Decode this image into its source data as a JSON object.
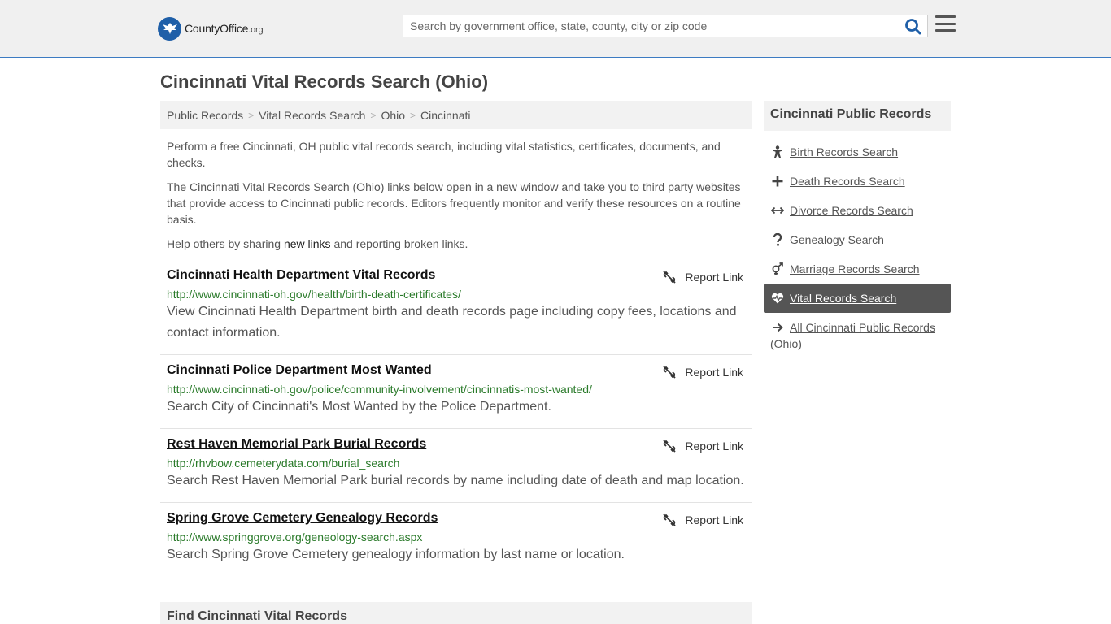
{
  "header": {
    "logo": {
      "brand": "CountyOffice",
      "tld": ".org"
    },
    "search_placeholder": "Search by government office, state, county, city or zip code"
  },
  "page_title": "Cincinnati Vital Records Search (Ohio)",
  "breadcrumb": [
    "Public Records",
    "Vital Records Search",
    "Ohio",
    "Cincinnati"
  ],
  "intro": {
    "p1": "Perform a free Cincinnati, OH public vital records search, including vital statistics, certificates, documents, and checks.",
    "p2": "The Cincinnati Vital Records Search (Ohio) links below open in a new window and take you to third party websites that provide access to Cincinnati public records. Editors frequently monitor and verify these resources on a routine basis.",
    "p3_before": "Help others by sharing ",
    "p3_link": "new links",
    "p3_after": " and reporting broken links."
  },
  "report_label": "Report Link",
  "results": [
    {
      "title": "Cincinnati Health Department Vital Records",
      "url": "http://www.cincinnati-oh.gov/health/birth-death-certificates/",
      "desc": "View Cincinnati Health Department birth and death records page including copy fees, locations and contact information."
    },
    {
      "title": "Cincinnati Police Department Most Wanted",
      "url": "http://www.cincinnati-oh.gov/police/community-involvement/cincinnatis-most-wanted/",
      "desc": "Search City of Cincinnati's Most Wanted by the Police Department."
    },
    {
      "title": "Rest Haven Memorial Park Burial Records",
      "url": "http://rhvbow.cemeterydata.com/burial_search",
      "desc": "Search Rest Haven Memorial Park burial records by name including date of death and map location."
    },
    {
      "title": "Spring Grove Cemetery Genealogy Records",
      "url": "http://www.springgrove.org/geneology-search.aspx",
      "desc": "Search Spring Grove Cemetery genealogy information by last name or location."
    }
  ],
  "find_heading": "Find Cincinnati Vital Records",
  "sidebar": {
    "heading": "Cincinnati Public Records",
    "items": [
      {
        "label": "Birth Records Search",
        "icon": "child-icon"
      },
      {
        "label": "Death Records Search",
        "icon": "cross-icon"
      },
      {
        "label": "Divorce Records Search",
        "icon": "arrows-horizontal-icon"
      },
      {
        "label": "Genealogy Search",
        "icon": "question-icon"
      },
      {
        "label": "Marriage Records Search",
        "icon": "gender-icon"
      },
      {
        "label": "Vital Records Search",
        "icon": "heartbeat-icon",
        "active": true
      },
      {
        "label": "All Cincinnati Public Records (Ohio)",
        "icon": "arrow-right-icon"
      }
    ]
  },
  "colors": {
    "accent_blue": "#3c7bc2",
    "url_green": "#2a7a2a",
    "active_bg": "#555555"
  }
}
